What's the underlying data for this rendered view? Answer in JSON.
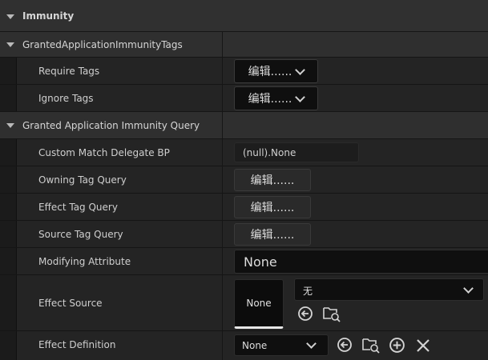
{
  "categories": {
    "immunity": "Immunity",
    "granted_tags": "GrantedApplicationImmunityTags",
    "granted_query": "Granted Application Immunity Query"
  },
  "rows": {
    "require_tags": {
      "label": "Require Tags",
      "button": "编辑......"
    },
    "ignore_tags": {
      "label": "Ignore Tags",
      "button": "编辑......"
    },
    "custom_match": {
      "label": "Custom Match Delegate BP",
      "value": "(null).None"
    },
    "owning_tag_query": {
      "label": "Owning Tag Query",
      "button": "编辑......"
    },
    "effect_tag_query": {
      "label": "Effect Tag Query",
      "button": "编辑......"
    },
    "source_tag_query": {
      "label": "Source Tag Query",
      "button": "编辑......"
    },
    "modifying_attribute": {
      "label": "Modifying Attribute",
      "value": "None"
    },
    "effect_source": {
      "label": "Effect Source",
      "thumbnail": "None",
      "dropdown": "无"
    },
    "effect_definition": {
      "label": "Effect Definition",
      "dropdown": "None"
    }
  }
}
